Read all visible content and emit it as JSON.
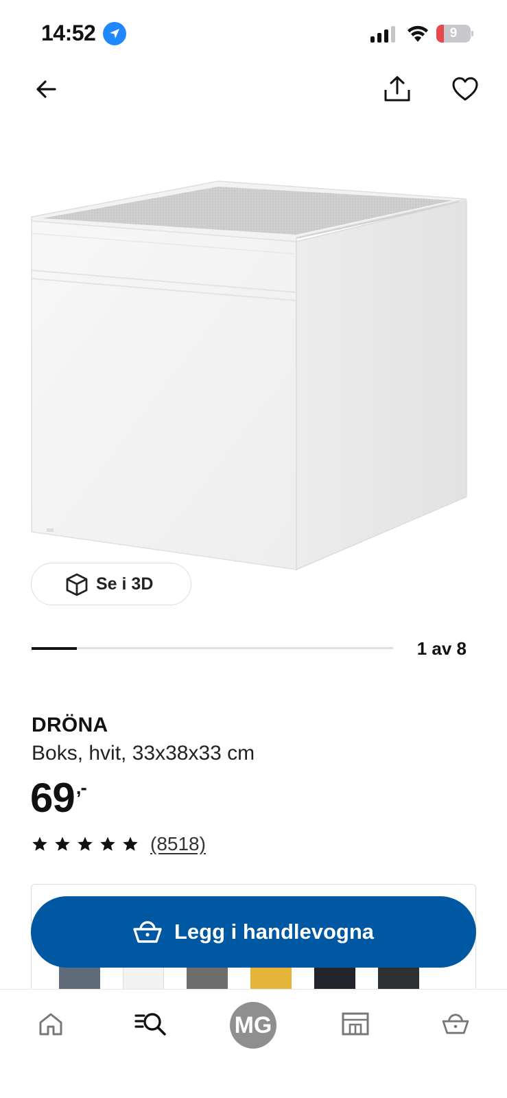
{
  "status_bar": {
    "time": "14:52",
    "battery_level": "9",
    "battery_color": "#e5484d"
  },
  "nav": {
    "back_icon": "arrow-left-icon",
    "share_icon": "share-icon",
    "favorite_icon": "heart-icon"
  },
  "gallery": {
    "view_3d_label": "Se i 3D",
    "counter": "1 av 8",
    "current_index": 1,
    "total": 8
  },
  "product": {
    "name": "DRÖNA",
    "description": "Boks, hvit, 33x38x33 cm",
    "price_main": "69",
    "price_suffix": ",-",
    "rating": 5,
    "review_count": "(8518)"
  },
  "variants": {
    "swatch_colors": [
      "#5f6b7a",
      "#f2f2f2",
      "#6d6d6d",
      "#e5b53a",
      "#22252b",
      "#2c3033"
    ]
  },
  "cta": {
    "add_to_cart_label": "Legg i handlevogna",
    "color": "#0058a3"
  },
  "tabbar": {
    "avatar_initials": "MG",
    "items": [
      "home-icon",
      "search-list-icon",
      "avatar",
      "store-icon",
      "basket-icon"
    ]
  }
}
